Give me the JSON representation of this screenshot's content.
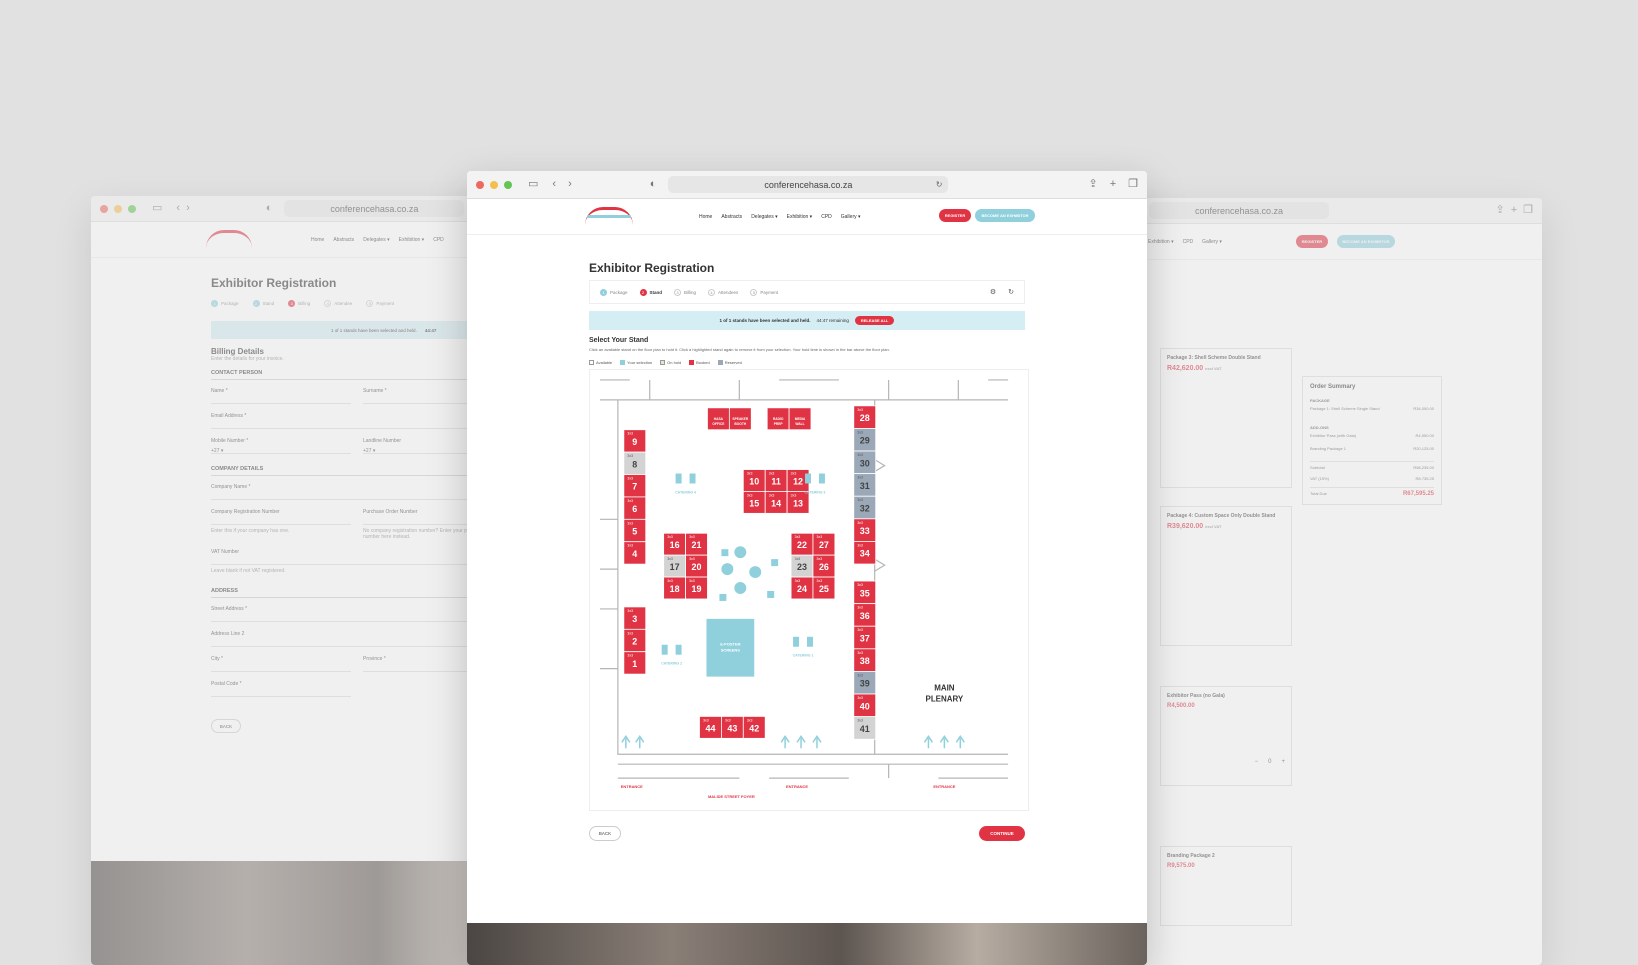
{
  "url": "conferencehasa.co.za",
  "nav_links": [
    "Home",
    "Abstracts",
    "Delegates ▾",
    "Exhibition ▾",
    "CPD",
    "Gallery ▾"
  ],
  "register_label": "REGISTER",
  "become_exhibitor_label": "BECOME AN EXHIBITOR",
  "page_title": "Exhibitor Registration",
  "steps": [
    "Package",
    "Stand",
    "Billing",
    "Attendees",
    "Payment"
  ],
  "steps_short": [
    "Package",
    "Stand",
    "Billing",
    "Attendee",
    "Payment"
  ],
  "hold_bar": {
    "text": "1 of 1 stands have been selected and held.",
    "remaining": "44:47 remaining",
    "remaining_short": "44:47",
    "release_label": "RELEASE ALL"
  },
  "select_title": "Select Your Stand",
  "select_desc": "Click an available stand on the floor plan to hold it. Click a highlighted stand again to remove it from your selection. Your hold time is shown in the bar above the floor plan.",
  "legend": [
    "Available",
    "Your selection",
    "On hold",
    "Booked",
    "Reserved"
  ],
  "colors": {
    "booked": "#e03445",
    "selection": "#8fd0dc",
    "on_hold": "#e9e2cf",
    "reserved": "#9aa8b8",
    "available": "#d3d3d3"
  },
  "floor": {
    "stand_size": "3x3",
    "services": [
      "HASA OFFICE",
      "SPEAKER BOOTH",
      "RADIO PREP",
      "MEDIA WALL"
    ],
    "catering": [
      "CATERING 4",
      "CATERING 3",
      "CATERING 2",
      "CATERING 1"
    ],
    "poster": "E-POSTER SCREENS",
    "plenary": "MAIN PLENARY",
    "entrance": "ENTRANCE",
    "foyer": "MALIDE STREET FOYER",
    "stands": {
      "left_col": [
        "9",
        "8",
        "7",
        "6",
        "5",
        "4"
      ],
      "left_low": [
        "3",
        "2",
        "1"
      ],
      "center_top": [
        "10",
        "11",
        "12",
        "15",
        "14",
        "13"
      ],
      "cl": [
        "16",
        "21",
        "17",
        "20",
        "18",
        "19"
      ],
      "cr": [
        "22",
        "27",
        "23",
        "26",
        "24",
        "25"
      ],
      "right_top": [
        "28",
        "29",
        "30",
        "31",
        "32",
        "33",
        "34"
      ],
      "right_low": [
        "35",
        "36",
        "37",
        "38",
        "39",
        "40",
        "41"
      ],
      "bottom": [
        "44",
        "43",
        "42"
      ]
    }
  },
  "back_label": "BACK",
  "continue_label": "CONTINUE",
  "billing": {
    "title": "Billing Details",
    "subtitle": "Enter the details for your invoice.",
    "contact_head": "CONTACT PERSON",
    "name": "Name *",
    "surname": "Surname *",
    "email": "Email Address *",
    "mobile": "Mobile Number *",
    "landline": "Landline Number",
    "country_code": "+27 ▾",
    "company_head": "COMPANY DETAILS",
    "company_name": "Company Name *",
    "reg_number": "Company Registration Number",
    "po_number": "Purchase Order Number",
    "reg_hint": "Enter this if your company has one.",
    "po_hint": "No company registration number? Enter your purchase order number here instead.",
    "vat": "VAT Number",
    "vat_hint": "Leave blank if not VAT registered.",
    "address_head": "ADDRESS",
    "street": "Street Address *",
    "line2": "Address Line 2",
    "city": "City *",
    "province": "Province *",
    "postal": "Postal Code *"
  },
  "right_panel": {
    "pkg3_title": "Package 3: Shell Scheme Double Stand",
    "pkg3_price": "R42,620.00",
    "pkg4_title": "Package 4: Custom Space Only Double Stand",
    "pkg4_price": "R39,620.00",
    "excl_vat": "excl VAT",
    "pass_title": "Exhibitor Pass (no Gala)",
    "pass_price": "R4,500.00",
    "qty": "0",
    "branding_title": "Branding Package 2",
    "branding_price": "R9,575.00",
    "summary_title": "Order Summary",
    "summary_package_head": "PACKAGE",
    "summary_package_item": "Package 1: Shell Scheme Single Stand",
    "summary_package_price": "R34,000.00",
    "summary_addons_head": "ADD-ONS",
    "summary_addon1": "Exhibitor Pass (with Gala)",
    "summary_addon1_price": "R4,950.00",
    "summary_addon2": "Branding Package 1",
    "summary_addon2_price": "R20,125.00",
    "subtotal_label": "Subtotal",
    "subtotal": "R58,235.00",
    "vat_label": "VAT (15%)",
    "vat_value": "R8,735.25",
    "total_label": "Total Due",
    "total": "R67,595.25"
  }
}
